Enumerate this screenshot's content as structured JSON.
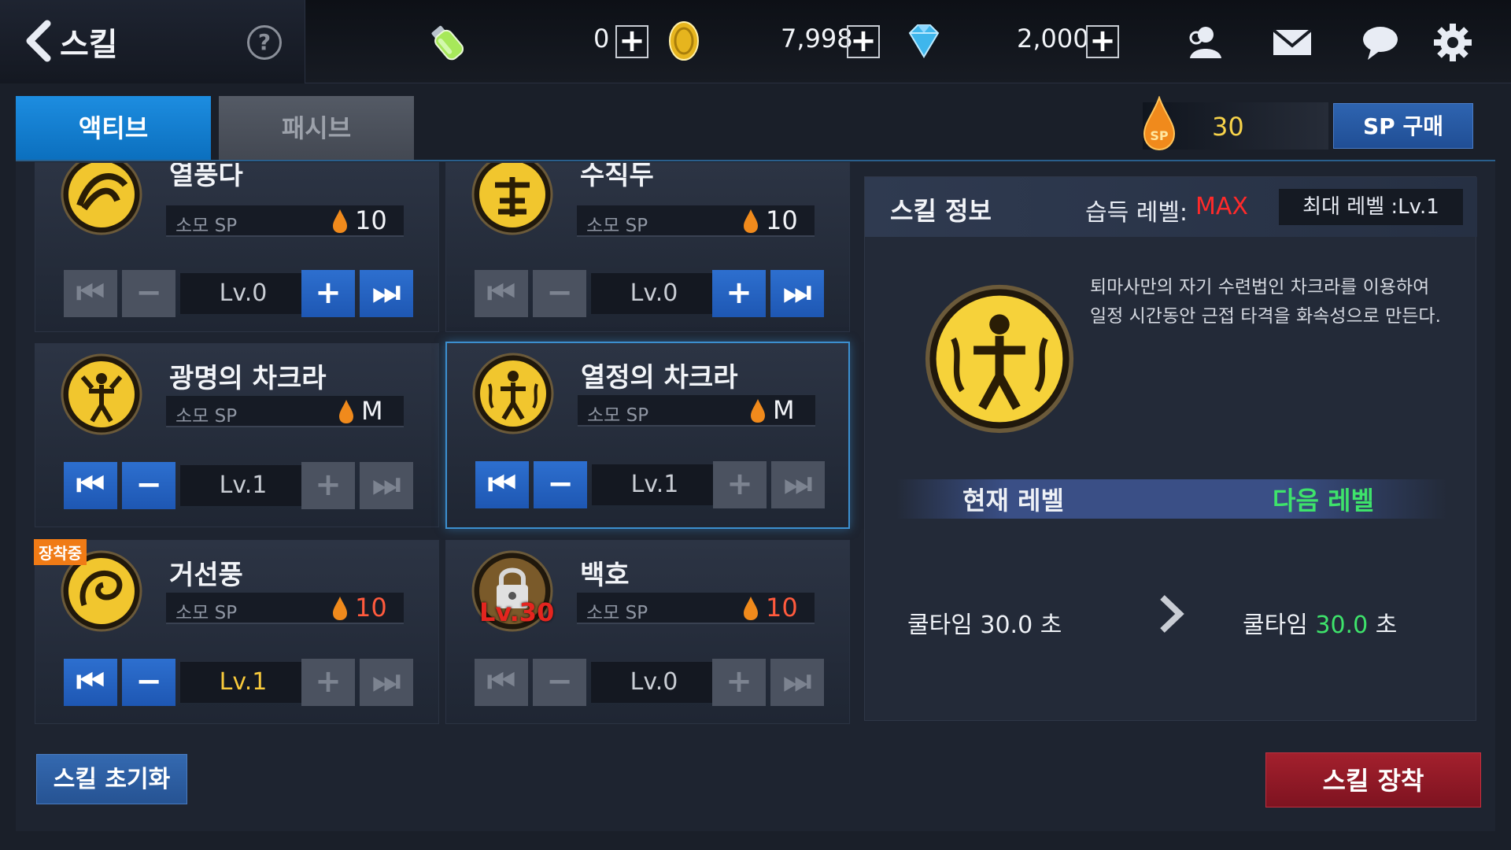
{
  "header": {
    "title": "스킬",
    "help_label": "?",
    "currencies": [
      {
        "name": "stamina",
        "icon": "stamina-potion-icon",
        "value": ""
      },
      {
        "name": "gold",
        "icon": "gold-coin-icon",
        "value": "0"
      },
      {
        "name": "gem",
        "icon": "blue-gem-icon",
        "value": "7,998"
      },
      {
        "name": "extra",
        "icon": "",
        "value": "2,000"
      }
    ],
    "plus_label": "+",
    "icons": [
      "friends-icon",
      "mail-icon",
      "chat-icon",
      "settings-icon"
    ]
  },
  "tabs": {
    "active": "액티브",
    "passive": "패시브"
  },
  "sp": {
    "amount": "30",
    "buy_label": "SP 구매",
    "icon_text": "SP"
  },
  "skills": [
    {
      "name": "열풍다",
      "sp_label": "소모 SP",
      "sp_cost": "10",
      "level": "Lv.0",
      "state": "upgradeable"
    },
    {
      "name": "수직두",
      "sp_label": "소모 SP",
      "sp_cost": "10",
      "level": "Lv.0",
      "state": "upgradeable"
    },
    {
      "name": "광명의 차크라",
      "sp_label": "소모 SP",
      "sp_cost": "M",
      "level": "Lv.1",
      "state": "maxed"
    },
    {
      "name": "열정의 차크라",
      "sp_label": "소모 SP",
      "sp_cost": "M",
      "level": "Lv.1",
      "state": "maxed",
      "selected": true
    },
    {
      "name": "거선풍",
      "sp_label": "소모 SP",
      "sp_cost": "10",
      "level": "Lv.1",
      "state": "equipped",
      "badge": "장착중"
    },
    {
      "name": "백호",
      "sp_label": "소모 SP",
      "sp_cost": "10",
      "level": "Lv.0",
      "state": "locked",
      "lock_level": "Lv.30"
    }
  ],
  "info": {
    "title": "스킬 정보",
    "acquired_label": "습득 레벨:",
    "acquired_value": "MAX",
    "max_level": "최대 레벨 :Lv.1",
    "description_line1": "퇴마사만의 자기 수련법인 차크라를 이용하여",
    "description_line2": "일정 시간동안 근접 타격을 화속성으로 만든다.",
    "current_level_label": "현재 레벨",
    "next_level_label": "다음 레벨",
    "cooldown_label": "쿨타임",
    "cooldown_current": "30.0",
    "cooldown_next": "30.0",
    "seconds_label": "초"
  },
  "buttons": {
    "reset": "스킬 초기화",
    "equip": "스킬 장착"
  },
  "colors": {
    "accent_blue": "#1d8de0",
    "sp_gold": "#f7d34a",
    "max_red": "#ff2a2a",
    "next_green": "#3ee36b",
    "equip_red": "#a3202d"
  }
}
